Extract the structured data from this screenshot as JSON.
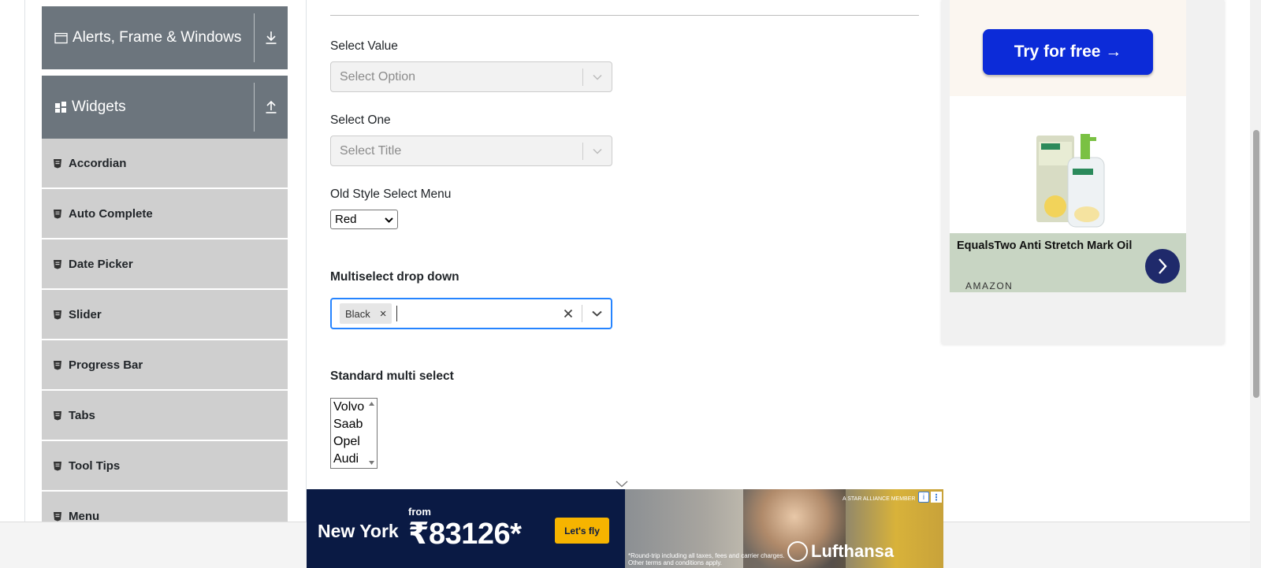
{
  "sidebar": {
    "groups": [
      {
        "label": "Alerts, Frame & Windows",
        "icon": "window-icon",
        "toggle_icon": "download-arrow-icon"
      },
      {
        "label": "Widgets",
        "icon": "grid-icon",
        "toggle_icon": "upload-arrow-icon"
      }
    ],
    "items": [
      {
        "label": "Accordian"
      },
      {
        "label": "Auto Complete"
      },
      {
        "label": "Date Picker"
      },
      {
        "label": "Slider"
      },
      {
        "label": "Progress Bar"
      },
      {
        "label": "Tabs"
      },
      {
        "label": "Tool Tips"
      },
      {
        "label": "Menu"
      }
    ]
  },
  "form": {
    "select_value": {
      "label": "Select Value",
      "placeholder": "Select Option"
    },
    "select_one": {
      "label": "Select One",
      "placeholder": "Select Title"
    },
    "old_style": {
      "label": "Old Style Select Menu",
      "value": "Red"
    },
    "multiselect": {
      "label": "Multiselect drop down",
      "chips": [
        "Black"
      ]
    },
    "standard_multi": {
      "label": "Standard multi select",
      "options": [
        "Volvo",
        "Saab",
        "Opel",
        "Audi"
      ]
    }
  },
  "ad_side": {
    "cta": "Try for free →",
    "product_name": "EqualsTwo Anti Stretch Mark Oil",
    "brand": "AMAZON"
  },
  "banner_ad": {
    "city": "New York",
    "from": "from",
    "price": "₹83126*",
    "cta": "Let's fly",
    "alliance": "A STAR ALLIANCE MEMBER",
    "brand": "Lufthansa",
    "fine_print": "*Round-trip including all taxes, fees and carrier charges. Other terms and conditions apply."
  },
  "colors": {
    "sidebar_header": "#6c757d",
    "sidebar_item": "#cfcfcf",
    "focus_border": "#2684ff",
    "cta_blue": "#0c2bd8",
    "banner_bg": "#0a1a44",
    "banner_cta": "#f6b400"
  }
}
